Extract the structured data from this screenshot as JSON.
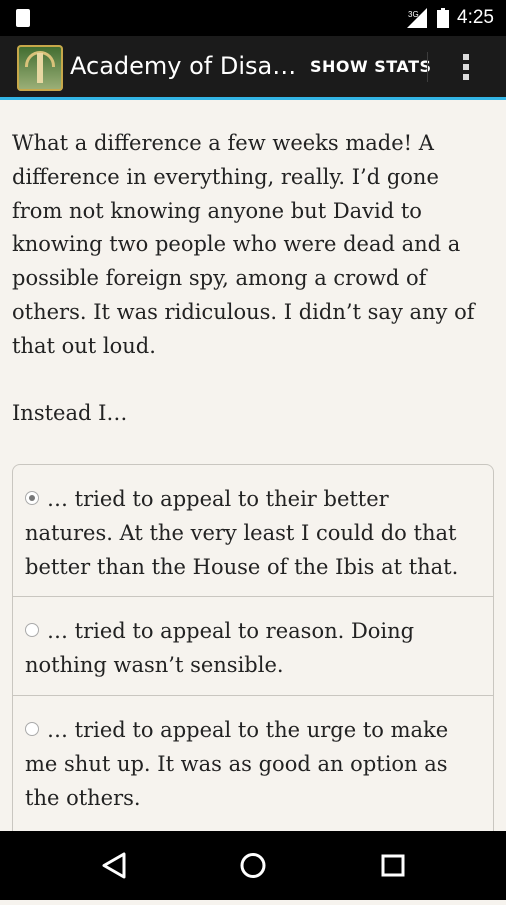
{
  "status_bar": {
    "time": "4:25",
    "network_type": "3G",
    "icons": [
      "notification-icon",
      "signal-icon",
      "battery-icon"
    ]
  },
  "action_bar": {
    "title": "Academy of Disa…",
    "show_stats_label": "SHOW STATS",
    "accent_color": "#33b5e5"
  },
  "story": {
    "paragraph1": "What a difference a few weeks made! A difference in everything, really. I’d gone from not knowing anyone but David to knowing two people who were dead and a possible foreign spy, among a crowd of others. It was ridiculous. I didn’t say any of that out loud.",
    "paragraph2": "Instead I…"
  },
  "choices": [
    {
      "text": "… tried to appeal to their better natures. At the very least I could do that better than the House of the Ibis at that.",
      "selected": true
    },
    {
      "text": "… tried to appeal to reason. Doing nothing wasn’t sensible.",
      "selected": false
    },
    {
      "text": "… tried to appeal to the urge to make me shut up. It was as good an option as the others.",
      "selected": false
    }
  ],
  "nav_bar": {
    "buttons": [
      "back-icon",
      "home-icon",
      "recents-icon"
    ]
  }
}
